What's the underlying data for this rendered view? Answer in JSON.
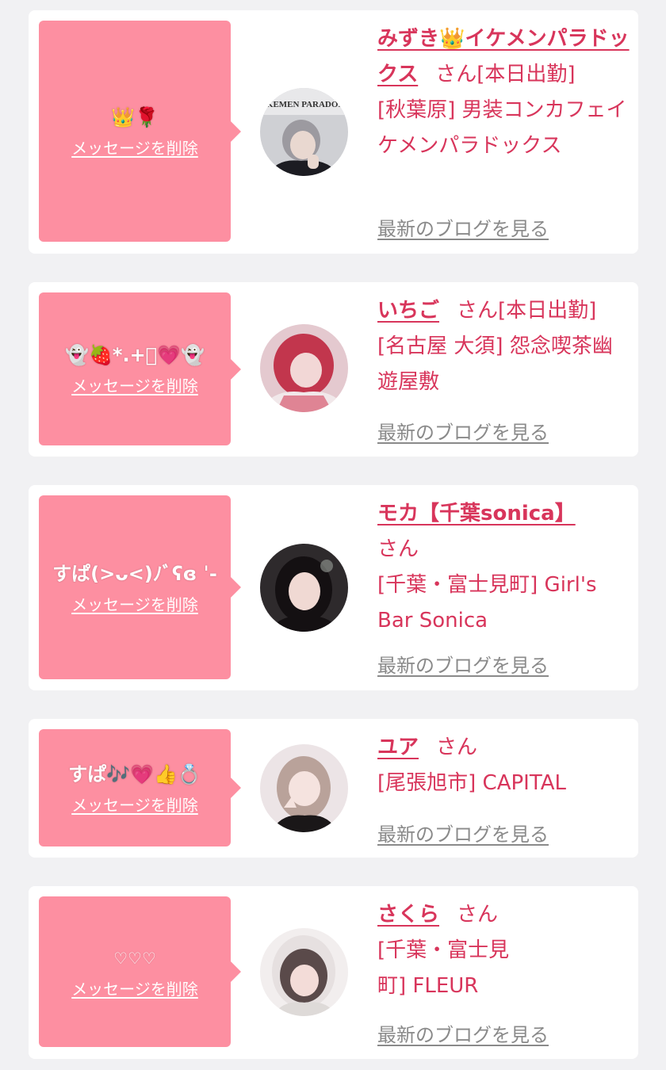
{
  "cards": [
    {
      "message": "👑🌹",
      "delete_label": "メッセージを削除",
      "name": "みずき👑イケメンパラドックス",
      "san": "さん",
      "status": "[本日出勤]",
      "shop": "[秋葉原] 男装コンカフェイケメンパラドックス",
      "blog_label": "最新のブログを見る",
      "avatar_text": "IKEMEN PARADOX"
    },
    {
      "message": "👻🍓*.+ﾟ💗👻",
      "delete_label": "メッセージを削除",
      "name": "いちご",
      "san": "さん",
      "status": "[本日出勤]",
      "shop": "[名古屋 大須] 怨念喫茶幽遊屋敷",
      "blog_label": "最新のブログを見る"
    },
    {
      "message": "すぱ(>ᴗ<)ﾉﾞʕɞ ˈ-",
      "delete_label": "メッセージを削除",
      "name": "モカ【千葉sonica】",
      "san": "さん",
      "shop": "[千葉・富士見町] Girl's Bar Sonica",
      "blog_label": "最新のブログを見る"
    },
    {
      "message": "すぱ🎶💗👍💍",
      "delete_label": "メッセージを削除",
      "name": "ユア",
      "san": "さん",
      "shop": "[尾張旭市] CAPITAL",
      "blog_label": "最新のブログを見る"
    },
    {
      "message": "♡♡♡",
      "delete_label": "メッセージを削除",
      "name": "さくら",
      "san": "さん",
      "shop": "[千葉・富士見町] FLEUR",
      "blog_label": "最新のブログを見る"
    }
  ]
}
